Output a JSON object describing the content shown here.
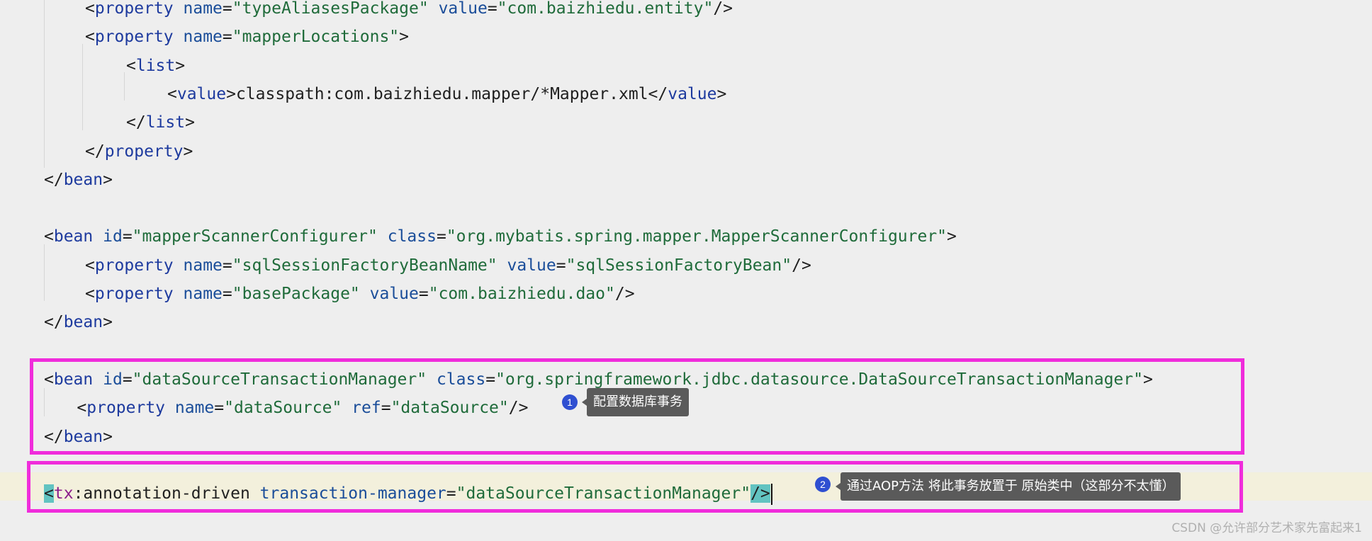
{
  "editor": {
    "lines": [
      {
        "indent": 2,
        "parts": [
          [
            "p",
            "<"
          ],
          [
            "t",
            "property"
          ],
          [
            "p",
            " "
          ],
          [
            "a",
            "name"
          ],
          [
            "p",
            "="
          ],
          [
            "v",
            "\"typeAliasesPackage\""
          ],
          [
            "p",
            " "
          ],
          [
            "a",
            "value"
          ],
          [
            "p",
            "="
          ],
          [
            "v",
            "\"com.baizhiedu.entity\""
          ],
          [
            "p",
            "/>"
          ]
        ]
      },
      {
        "indent": 2,
        "parts": [
          [
            "p",
            "<"
          ],
          [
            "t",
            "property"
          ],
          [
            "p",
            " "
          ],
          [
            "a",
            "name"
          ],
          [
            "p",
            "="
          ],
          [
            "v",
            "\"mapperLocations\""
          ],
          [
            "p",
            ">"
          ]
        ]
      },
      {
        "indent": 3,
        "parts": [
          [
            "p",
            "<"
          ],
          [
            "t",
            "list"
          ],
          [
            "p",
            ">"
          ]
        ]
      },
      {
        "indent": 4,
        "parts": [
          [
            "p",
            "<"
          ],
          [
            "t",
            "value"
          ],
          [
            "p",
            ">classpath:com.baizhiedu.mapper/*Mapper.xml</"
          ],
          [
            "t",
            "value"
          ],
          [
            "p",
            ">"
          ]
        ]
      },
      {
        "indent": 3,
        "parts": [
          [
            "p",
            "</"
          ],
          [
            "t",
            "list"
          ],
          [
            "p",
            ">"
          ]
        ]
      },
      {
        "indent": 2,
        "parts": [
          [
            "p",
            "</"
          ],
          [
            "t",
            "property"
          ],
          [
            "p",
            ">"
          ]
        ]
      },
      {
        "indent": 1,
        "parts": [
          [
            "p",
            "</"
          ],
          [
            "t",
            "bean"
          ],
          [
            "p",
            ">"
          ]
        ]
      },
      {
        "indent": 0,
        "parts": []
      },
      {
        "indent": 1,
        "parts": [
          [
            "p",
            "<"
          ],
          [
            "t",
            "bean"
          ],
          [
            "p",
            " "
          ],
          [
            "a",
            "id"
          ],
          [
            "p",
            "="
          ],
          [
            "v",
            "\"mapperScannerConfigurer\""
          ],
          [
            "p",
            " "
          ],
          [
            "a",
            "class"
          ],
          [
            "p",
            "="
          ],
          [
            "v",
            "\"org.mybatis.spring.mapper.MapperScannerConfigurer\""
          ],
          [
            "p",
            ">"
          ]
        ]
      },
      {
        "indent": 2,
        "parts": [
          [
            "p",
            "<"
          ],
          [
            "t",
            "property"
          ],
          [
            "p",
            " "
          ],
          [
            "a",
            "name"
          ],
          [
            "p",
            "="
          ],
          [
            "v",
            "\"sqlSessionFactoryBeanName\""
          ],
          [
            "p",
            " "
          ],
          [
            "a",
            "value"
          ],
          [
            "p",
            "="
          ],
          [
            "v",
            "\"sqlSessionFactoryBean\""
          ],
          [
            "p",
            "/>"
          ]
        ]
      },
      {
        "indent": 2,
        "parts": [
          [
            "p",
            "<"
          ],
          [
            "t",
            "property"
          ],
          [
            "p",
            " "
          ],
          [
            "a",
            "name"
          ],
          [
            "p",
            "="
          ],
          [
            "v",
            "\"basePackage\""
          ],
          [
            "p",
            " "
          ],
          [
            "a",
            "value"
          ],
          [
            "p",
            "="
          ],
          [
            "v",
            "\"com.baizhiedu.dao\""
          ],
          [
            "p",
            "/>"
          ]
        ]
      },
      {
        "indent": 1,
        "parts": [
          [
            "p",
            "</"
          ],
          [
            "t",
            "bean"
          ],
          [
            "p",
            ">"
          ]
        ]
      },
      {
        "indent": 0,
        "parts": []
      },
      {
        "indent": 1,
        "parts": [
          [
            "p",
            "<"
          ],
          [
            "t",
            "bean"
          ],
          [
            "p",
            " "
          ],
          [
            "a",
            "id"
          ],
          [
            "p",
            "="
          ],
          [
            "v",
            "\"dataSourceTransactionManager\""
          ],
          [
            "p",
            " "
          ],
          [
            "a",
            "class"
          ],
          [
            "p",
            "="
          ],
          [
            "v",
            "\"org.springframework.jdbc.datasource.DataSourceTransactionManager\""
          ],
          [
            "p",
            ">"
          ]
        ]
      },
      {
        "indent": 2,
        "parts": [
          [
            "p",
            "<"
          ],
          [
            "t",
            "property"
          ],
          [
            "p",
            " "
          ],
          [
            "a",
            "name"
          ],
          [
            "p",
            "="
          ],
          [
            "v",
            "\"dataSource\""
          ],
          [
            "p",
            " "
          ],
          [
            "a",
            "ref"
          ],
          [
            "p",
            "="
          ],
          [
            "v",
            "\"dataSource\""
          ],
          [
            "p",
            "/>"
          ]
        ]
      },
      {
        "indent": 1,
        "parts": [
          [
            "p",
            "</"
          ],
          [
            "t",
            "bean"
          ],
          [
            "p",
            ">"
          ]
        ]
      },
      {
        "indent": 0,
        "parts": []
      },
      {
        "indent": 1,
        "parts": [
          [
            "match",
            "<"
          ],
          [
            "ns",
            "tx"
          ],
          [
            "p",
            ":annotation-driven "
          ],
          [
            "a",
            "transaction-manager"
          ],
          [
            "p",
            "="
          ],
          [
            "v",
            "\"dataSourceTransactionManager\""
          ],
          [
            "match",
            "/>"
          ]
        ]
      }
    ]
  },
  "annotations": [
    {
      "number": "1",
      "text": "配置数据库事务"
    },
    {
      "number": "2",
      "text": "通过AOP方法 将此事务放置于 原始类中（这部分不太懂）"
    }
  ],
  "watermark": "CSDN @允许部分艺术家先富起来1",
  "colors": {
    "highlight_box": "#f02cdb",
    "tooltip_bg": "#5a5a5a",
    "bubble": "#2f4fd1"
  }
}
